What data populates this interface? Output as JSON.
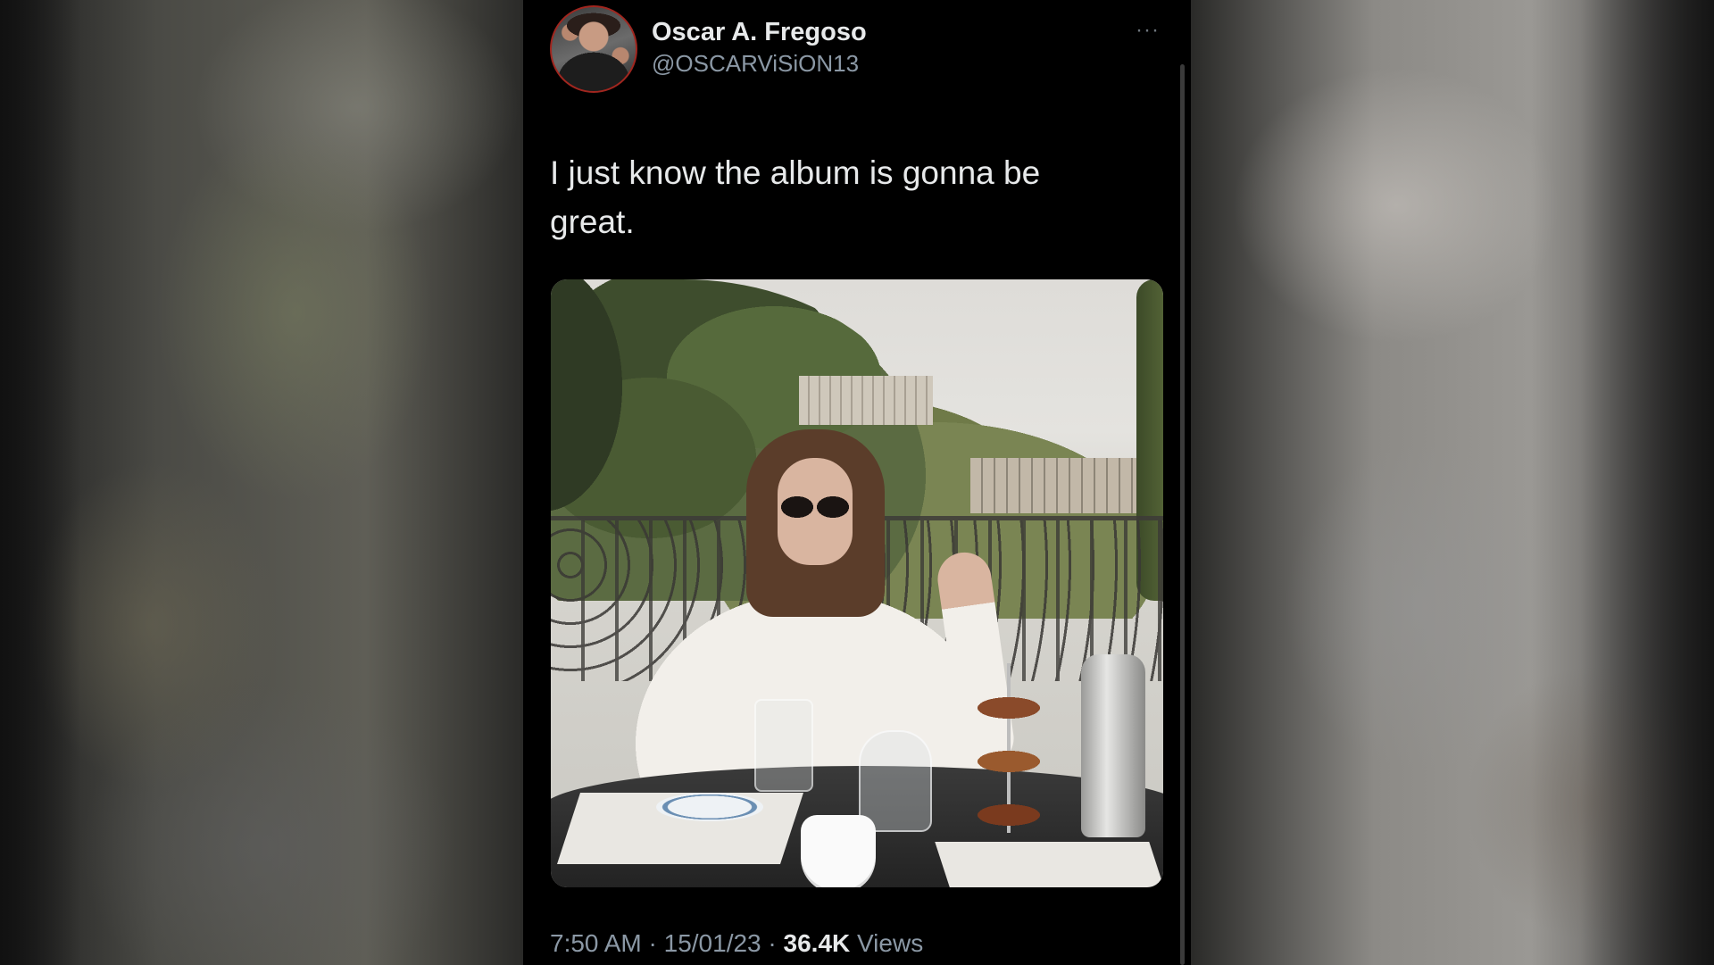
{
  "tweet": {
    "author_name": "Oscar A. Fregoso",
    "author_handle": "@OSCARViSiON13",
    "text": "I just know the album is gonna be great.",
    "time": "7:50 AM",
    "date": "15/01/23",
    "separator": "·",
    "views_count": "36.4K",
    "views_label": "Views",
    "more_icon": "···"
  },
  "icons": {
    "more": "more-horizontal-icon"
  },
  "colors": {
    "panel_background": "#000000",
    "text_primary": "#e7e9ea",
    "text_secondary": "#8b98a5"
  }
}
